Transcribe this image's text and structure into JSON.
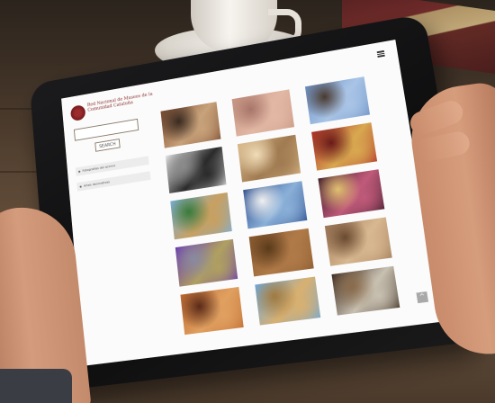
{
  "site": {
    "title": "Red Nacional de Museos de la Comunidad Cataluña",
    "logo_color": "#8a2a2a"
  },
  "search": {
    "placeholder": "",
    "button_label": "SEARCH"
  },
  "filters": [
    {
      "label": "Fotografías del acervo"
    },
    {
      "label": "Artes decorativas"
    }
  ],
  "menu": {
    "icon": "menu-icon"
  },
  "gallery": {
    "items": [
      {
        "subject": "terracotta-sculpture",
        "colors": [
          "#7a4a30",
          "#c8a27a",
          "#3a2a20"
        ]
      },
      {
        "subject": "pink-stucco-relief",
        "colors": [
          "#c89784",
          "#e2b8a4",
          "#a8756a"
        ]
      },
      {
        "subject": "tree-branches-sky",
        "colors": [
          "#6a8fc4",
          "#a9c4e6",
          "#4a3a30"
        ]
      },
      {
        "subject": "ironwork-drawing",
        "colors": [
          "#e8e8e8",
          "#2a2a2a",
          "#8a8a8a"
        ]
      },
      {
        "subject": "carved-stone-facade",
        "colors": [
          "#d8b88a",
          "#a07a50",
          "#f0dcb8"
        ]
      },
      {
        "subject": "red-tile-mosaic",
        "colors": [
          "#b0302a",
          "#d8a850",
          "#6a1a18"
        ]
      },
      {
        "subject": "thatched-house",
        "colors": [
          "#7ab0e0",
          "#c8a060",
          "#3a7a3a"
        ]
      },
      {
        "subject": "stained-glass-dome",
        "colors": [
          "#2a4a8a",
          "#8ab0d8",
          "#f0f0f0"
        ]
      },
      {
        "subject": "ornate-tile-pattern",
        "colors": [
          "#3a1a2a",
          "#c05a7a",
          "#e0c070"
        ]
      },
      {
        "subject": "blue-map",
        "colors": [
          "#6a3ab0",
          "#b0a060",
          "#8a8aa0"
        ]
      },
      {
        "subject": "wooden-texture",
        "colors": [
          "#8a5a30",
          "#b07a48",
          "#5a3a1a"
        ]
      },
      {
        "subject": "shell-pattern",
        "colors": [
          "#a07a5a",
          "#d8b890",
          "#6a4a30"
        ]
      },
      {
        "subject": "patterned-textile",
        "colors": [
          "#c06a30",
          "#e0a060",
          "#5a2a18"
        ]
      },
      {
        "subject": "church-tower",
        "colors": [
          "#6aa8e0",
          "#d8b070",
          "#a07a40"
        ]
      },
      {
        "subject": "crafts-display",
        "colors": [
          "#3a2a20",
          "#c8c0b0",
          "#8a6a4a"
        ]
      }
    ]
  },
  "scroll_top": {
    "icon": "chevron-up-icon",
    "glyph": "^"
  }
}
